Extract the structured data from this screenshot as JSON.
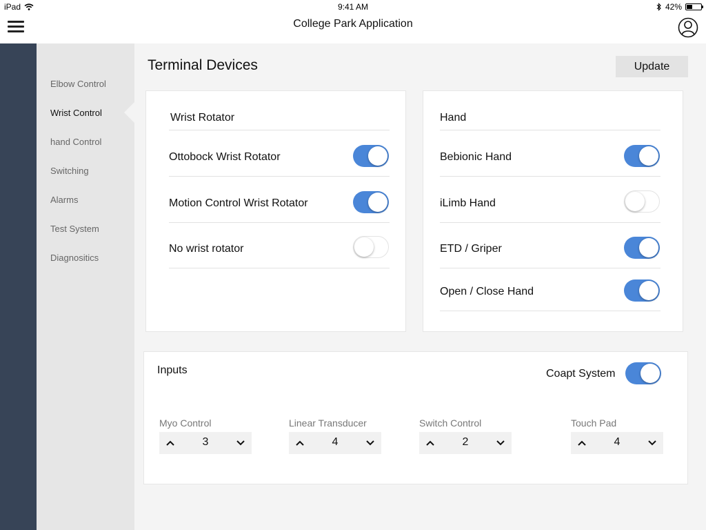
{
  "status_bar": {
    "device": "iPad",
    "time": "9:41 AM",
    "battery": "42%",
    "battery_level": 0.42
  },
  "nav": {
    "title": "College Park Application"
  },
  "sidebar": {
    "items": [
      {
        "label": "Elbow Control",
        "active": false
      },
      {
        "label": "Wrist Control",
        "active": true
      },
      {
        "label": "hand Control",
        "active": false
      },
      {
        "label": "Switching",
        "active": false
      },
      {
        "label": "Alarms",
        "active": false
      },
      {
        "label": "Test System",
        "active": false
      },
      {
        "label": "Diagnositics",
        "active": false
      }
    ]
  },
  "main": {
    "title": "Terminal Devices",
    "update_label": "Update",
    "wrist": {
      "title": "Wrist Rotator",
      "rows": [
        {
          "label": "Ottobock Wrist Rotator",
          "on": true
        },
        {
          "label": "Motion Control Wrist Rotator",
          "on": true
        },
        {
          "label": "No wrist rotator",
          "on": false
        }
      ]
    },
    "hand": {
      "title": "Hand",
      "rows": [
        {
          "label": "Bebionic Hand",
          "on": true
        },
        {
          "label": "iLimb Hand",
          "on": false
        },
        {
          "label": "ETD / Griper",
          "on": true
        },
        {
          "label": "Open / Close Hand",
          "on": true
        }
      ]
    },
    "inputs": {
      "title": "Inputs",
      "coapt_label": "Coapt System",
      "coapt_on": true,
      "items": [
        {
          "label": "Myo Control",
          "value": "3"
        },
        {
          "label": "Linear Transducer",
          "value": "4"
        },
        {
          "label": "Switch Control",
          "value": "2"
        },
        {
          "label": "Touch Pad",
          "value": "4"
        }
      ]
    }
  },
  "colors": {
    "accent": "#4a86d8",
    "rail": "#374457",
    "sidebar": "#e6e6e6"
  }
}
